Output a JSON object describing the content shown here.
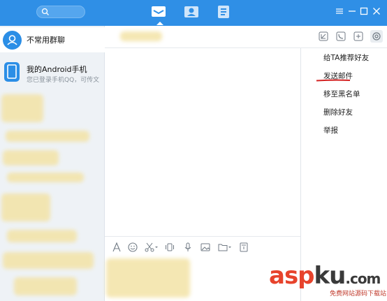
{
  "colors": {
    "accent": "#2f8fe6",
    "sidebar_bg": "#eef2f6",
    "watermark": "#e7432c"
  },
  "top_tabs": [
    {
      "icon": "message-icon",
      "active": true
    },
    {
      "icon": "contacts-icon",
      "active": false
    },
    {
      "icon": "space-icon",
      "active": false
    }
  ],
  "sidebar": {
    "items": [
      {
        "title": "不常用群聊",
        "icon": "group-icon"
      },
      {
        "title": "我的Android手机",
        "subtitle": "您已登录手机QQ，可传文",
        "icon": "phone-icon"
      }
    ]
  },
  "menu": {
    "items": [
      "给TA推荐好友",
      "发送邮件",
      "移至黑名单",
      "删除好友",
      "举报"
    ]
  },
  "watermark": {
    "brand_left": "asp",
    "brand_mid": "ku",
    "brand_right": ".com",
    "sub": "免费网站源码下载站!"
  }
}
